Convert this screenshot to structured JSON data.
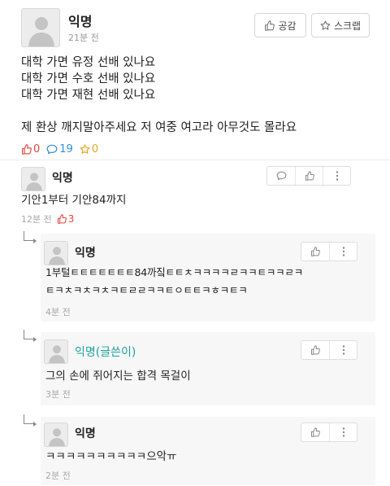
{
  "post": {
    "author": "익명",
    "time": "21분 전",
    "like_button": "공감",
    "scrap_button": "스크랩",
    "lines": [
      "대학 가면 유정 선배 있나요",
      "대학 가면 수호 선배 있나요",
      "대학 가면 재현 선배 있나요",
      "",
      "제 환상 깨지말아주세요 저 여중 여고라 아무것도 몰라요"
    ],
    "stats": {
      "likes": "0",
      "comments": "19",
      "scraps": "0"
    }
  },
  "comments": [
    {
      "author": "익명",
      "text": "기안1부터 기안84까지",
      "time": "12분 전",
      "likes": "3"
    }
  ],
  "replies": [
    {
      "author": "익명",
      "lines": [
        "1부털ㅌㅌㅌㅌㅌㅌㅌ84까짘ㅌㅌㅊㅋㅋㅋㅋㄹㅋㅋㅌㅋㅋㄹㅋ",
        "ㅌㅋㅊㅋㅊㅋㅊㅋㅌㄹㄹㅋㅋㅌㅇㅌㅌㅋㅎㅋㅌㅋ"
      ],
      "time": "4분 전"
    },
    {
      "author": "익명(글쓴이)",
      "lines": [
        "그의 손에 쥐어지는 합격 목걸이"
      ],
      "time": "3분 전"
    },
    {
      "author": "익명",
      "lines": [
        "ㅋㅋㅋㅋㅋㅋㅋㅋㅋㅋ으악ㅠ"
      ],
      "time": "2분 전"
    }
  ],
  "colors": {
    "like": "#e0483b",
    "comment": "#2f8fd9",
    "scrap": "#e0a626",
    "writer": "#1ba39c"
  },
  "icons": {
    "avatar": "avatar-placeholder-icon",
    "like": "thumbs-up-icon",
    "scrap": "star-icon",
    "comment": "speech-bubble-icon",
    "more": "more-vertical-icon",
    "reply": "reply-arrow-icon"
  }
}
